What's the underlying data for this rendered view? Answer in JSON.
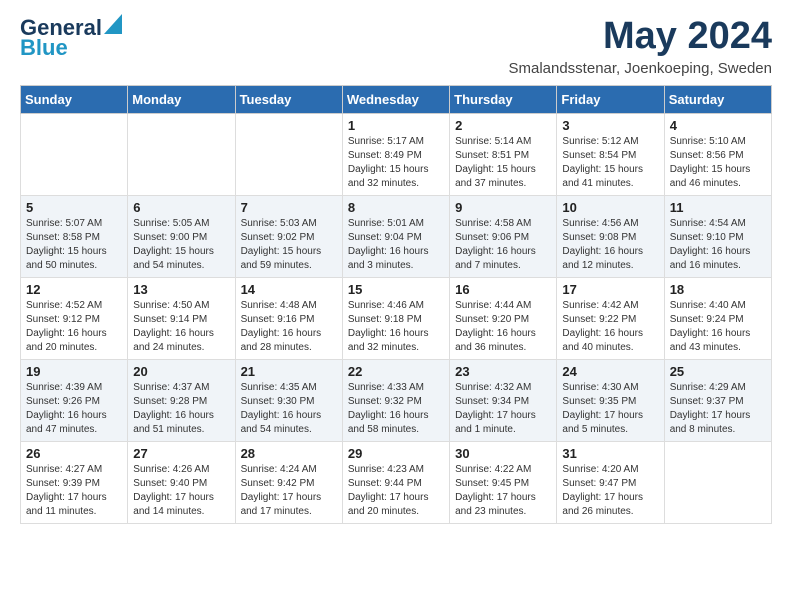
{
  "header": {
    "logo_line1": "General",
    "logo_line2": "Blue",
    "title": "May 2024",
    "subtitle": "Smalandsstenar, Joenkoeping, Sweden"
  },
  "weekdays": [
    "Sunday",
    "Monday",
    "Tuesday",
    "Wednesday",
    "Thursday",
    "Friday",
    "Saturday"
  ],
  "weeks": [
    [
      {
        "day": "",
        "sunrise": "",
        "sunset": "",
        "daylight": ""
      },
      {
        "day": "",
        "sunrise": "",
        "sunset": "",
        "daylight": ""
      },
      {
        "day": "",
        "sunrise": "",
        "sunset": "",
        "daylight": ""
      },
      {
        "day": "1",
        "sunrise": "Sunrise: 5:17 AM",
        "sunset": "Sunset: 8:49 PM",
        "daylight": "Daylight: 15 hours and 32 minutes."
      },
      {
        "day": "2",
        "sunrise": "Sunrise: 5:14 AM",
        "sunset": "Sunset: 8:51 PM",
        "daylight": "Daylight: 15 hours and 37 minutes."
      },
      {
        "day": "3",
        "sunrise": "Sunrise: 5:12 AM",
        "sunset": "Sunset: 8:54 PM",
        "daylight": "Daylight: 15 hours and 41 minutes."
      },
      {
        "day": "4",
        "sunrise": "Sunrise: 5:10 AM",
        "sunset": "Sunset: 8:56 PM",
        "daylight": "Daylight: 15 hours and 46 minutes."
      }
    ],
    [
      {
        "day": "5",
        "sunrise": "Sunrise: 5:07 AM",
        "sunset": "Sunset: 8:58 PM",
        "daylight": "Daylight: 15 hours and 50 minutes."
      },
      {
        "day": "6",
        "sunrise": "Sunrise: 5:05 AM",
        "sunset": "Sunset: 9:00 PM",
        "daylight": "Daylight: 15 hours and 54 minutes."
      },
      {
        "day": "7",
        "sunrise": "Sunrise: 5:03 AM",
        "sunset": "Sunset: 9:02 PM",
        "daylight": "Daylight: 15 hours and 59 minutes."
      },
      {
        "day": "8",
        "sunrise": "Sunrise: 5:01 AM",
        "sunset": "Sunset: 9:04 PM",
        "daylight": "Daylight: 16 hours and 3 minutes."
      },
      {
        "day": "9",
        "sunrise": "Sunrise: 4:58 AM",
        "sunset": "Sunset: 9:06 PM",
        "daylight": "Daylight: 16 hours and 7 minutes."
      },
      {
        "day": "10",
        "sunrise": "Sunrise: 4:56 AM",
        "sunset": "Sunset: 9:08 PM",
        "daylight": "Daylight: 16 hours and 12 minutes."
      },
      {
        "day": "11",
        "sunrise": "Sunrise: 4:54 AM",
        "sunset": "Sunset: 9:10 PM",
        "daylight": "Daylight: 16 hours and 16 minutes."
      }
    ],
    [
      {
        "day": "12",
        "sunrise": "Sunrise: 4:52 AM",
        "sunset": "Sunset: 9:12 PM",
        "daylight": "Daylight: 16 hours and 20 minutes."
      },
      {
        "day": "13",
        "sunrise": "Sunrise: 4:50 AM",
        "sunset": "Sunset: 9:14 PM",
        "daylight": "Daylight: 16 hours and 24 minutes."
      },
      {
        "day": "14",
        "sunrise": "Sunrise: 4:48 AM",
        "sunset": "Sunset: 9:16 PM",
        "daylight": "Daylight: 16 hours and 28 minutes."
      },
      {
        "day": "15",
        "sunrise": "Sunrise: 4:46 AM",
        "sunset": "Sunset: 9:18 PM",
        "daylight": "Daylight: 16 hours and 32 minutes."
      },
      {
        "day": "16",
        "sunrise": "Sunrise: 4:44 AM",
        "sunset": "Sunset: 9:20 PM",
        "daylight": "Daylight: 16 hours and 36 minutes."
      },
      {
        "day": "17",
        "sunrise": "Sunrise: 4:42 AM",
        "sunset": "Sunset: 9:22 PM",
        "daylight": "Daylight: 16 hours and 40 minutes."
      },
      {
        "day": "18",
        "sunrise": "Sunrise: 4:40 AM",
        "sunset": "Sunset: 9:24 PM",
        "daylight": "Daylight: 16 hours and 43 minutes."
      }
    ],
    [
      {
        "day": "19",
        "sunrise": "Sunrise: 4:39 AM",
        "sunset": "Sunset: 9:26 PM",
        "daylight": "Daylight: 16 hours and 47 minutes."
      },
      {
        "day": "20",
        "sunrise": "Sunrise: 4:37 AM",
        "sunset": "Sunset: 9:28 PM",
        "daylight": "Daylight: 16 hours and 51 minutes."
      },
      {
        "day": "21",
        "sunrise": "Sunrise: 4:35 AM",
        "sunset": "Sunset: 9:30 PM",
        "daylight": "Daylight: 16 hours and 54 minutes."
      },
      {
        "day": "22",
        "sunrise": "Sunrise: 4:33 AM",
        "sunset": "Sunset: 9:32 PM",
        "daylight": "Daylight: 16 hours and 58 minutes."
      },
      {
        "day": "23",
        "sunrise": "Sunrise: 4:32 AM",
        "sunset": "Sunset: 9:34 PM",
        "daylight": "Daylight: 17 hours and 1 minute."
      },
      {
        "day": "24",
        "sunrise": "Sunrise: 4:30 AM",
        "sunset": "Sunset: 9:35 PM",
        "daylight": "Daylight: 17 hours and 5 minutes."
      },
      {
        "day": "25",
        "sunrise": "Sunrise: 4:29 AM",
        "sunset": "Sunset: 9:37 PM",
        "daylight": "Daylight: 17 hours and 8 minutes."
      }
    ],
    [
      {
        "day": "26",
        "sunrise": "Sunrise: 4:27 AM",
        "sunset": "Sunset: 9:39 PM",
        "daylight": "Daylight: 17 hours and 11 minutes."
      },
      {
        "day": "27",
        "sunrise": "Sunrise: 4:26 AM",
        "sunset": "Sunset: 9:40 PM",
        "daylight": "Daylight: 17 hours and 14 minutes."
      },
      {
        "day": "28",
        "sunrise": "Sunrise: 4:24 AM",
        "sunset": "Sunset: 9:42 PM",
        "daylight": "Daylight: 17 hours and 17 minutes."
      },
      {
        "day": "29",
        "sunrise": "Sunrise: 4:23 AM",
        "sunset": "Sunset: 9:44 PM",
        "daylight": "Daylight: 17 hours and 20 minutes."
      },
      {
        "day": "30",
        "sunrise": "Sunrise: 4:22 AM",
        "sunset": "Sunset: 9:45 PM",
        "daylight": "Daylight: 17 hours and 23 minutes."
      },
      {
        "day": "31",
        "sunrise": "Sunrise: 4:20 AM",
        "sunset": "Sunset: 9:47 PM",
        "daylight": "Daylight: 17 hours and 26 minutes."
      },
      {
        "day": "",
        "sunrise": "",
        "sunset": "",
        "daylight": ""
      }
    ]
  ]
}
